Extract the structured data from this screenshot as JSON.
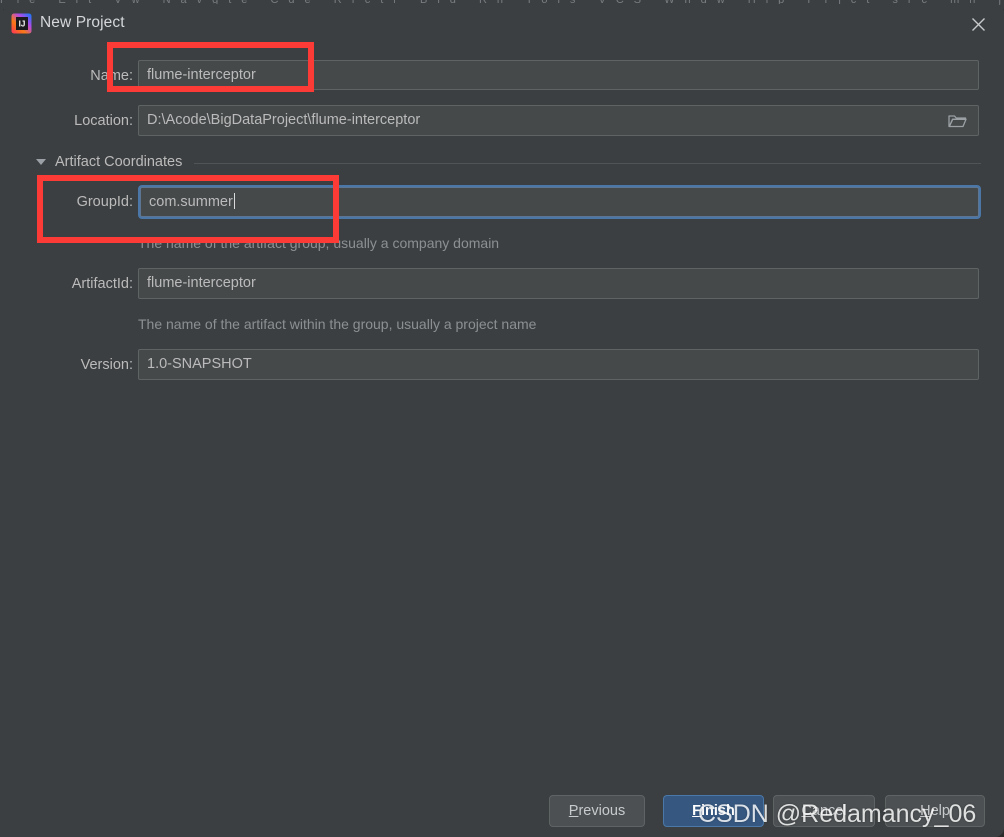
{
  "window": {
    "title": "New Project",
    "app_icon": "intellij-idea-icon",
    "close_icon": "close-icon"
  },
  "form": {
    "name": {
      "label": "Name:",
      "value": "flume-interceptor"
    },
    "location": {
      "label": "Location:",
      "value": "D:\\Acode\\BigDataProject\\flume-interceptor",
      "browse_icon": "folder-browse-icon"
    },
    "section": {
      "label": "Artifact Coordinates",
      "expander_icon": "triangle-down-icon"
    },
    "group_id": {
      "label": "GroupId:",
      "value": "com.summer",
      "hint": "The name of the artifact group, usually a company domain"
    },
    "artifact_id": {
      "label": "ArtifactId:",
      "value": "flume-interceptor",
      "hint": "The name of the artifact within the group, usually a project name"
    },
    "version": {
      "label": "Version:",
      "value": "1.0-SNAPSHOT"
    }
  },
  "buttons": {
    "previous": {
      "mnemonic": "P",
      "rest": "revious"
    },
    "finish": {
      "mnemonic": "F",
      "rest": "inish"
    },
    "cancel": {
      "mnemonic": "C",
      "rest": "ancel"
    },
    "help": {
      "mnemonic": "H",
      "rest": "elp"
    }
  },
  "watermark": {
    "text": "CSDN @Redamancy_06"
  },
  "colors": {
    "dialog_bg": "#3c3f41",
    "field_bg": "#45494a",
    "field_border": "#5e6364",
    "focus_ring": "#4a77a8",
    "primary_button": "#365880",
    "annotation": "#fd3b36",
    "text": "#bbbbbb",
    "hint_text": "#8c9093"
  }
}
